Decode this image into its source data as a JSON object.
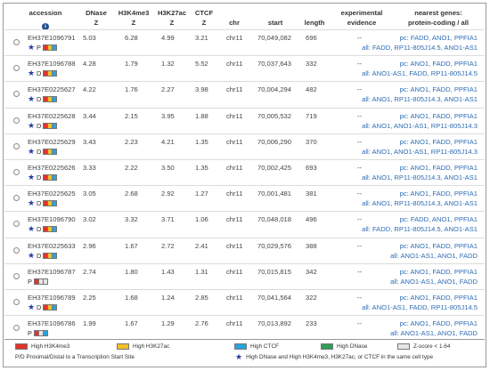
{
  "headers": {
    "accession": "accession",
    "dnase_1": "DNase",
    "dnase_2": "Z",
    "h3k4me3_1": "H3K4me3",
    "h3k4me3_2": "Z",
    "h3k27ac_1": "H3K27ac",
    "h3k27ac_2": "Z",
    "ctcf_1": "CTCF",
    "ctcf_2": "Z",
    "chr": "chr",
    "start": "start",
    "length": "length",
    "exp_1": "experimental",
    "exp_2": "evidence",
    "genes_1": "nearest genes:",
    "genes_2": "protein-coding / all"
  },
  "info_icon": "i",
  "colors": {
    "red": "#e0342c",
    "yellow": "#f2c027",
    "blue": "#2aa3de",
    "green": "#2f9e58",
    "gray": "#e6e6e6"
  },
  "rows": [
    {
      "acc": "EH37E1096791",
      "mark": "P",
      "star": true,
      "swatches": [
        "red",
        "yellow",
        "blue"
      ],
      "dnase": "5.03",
      "h3k4me3": "6.28",
      "h3k27ac": "4.99",
      "ctcf": "3.21",
      "chr": "chr11",
      "start": "70,049,082",
      "length": "696",
      "exp": "--",
      "pc": "pc: FADD, ANO1, PPFIA1",
      "all": "all: FADD, RP11-805J14.5, ANO1-AS1"
    },
    {
      "acc": "EH37E1096788",
      "mark": "D",
      "star": true,
      "swatches": [
        "red",
        "yellow",
        "blue"
      ],
      "dnase": "4.28",
      "h3k4me3": "1.79",
      "h3k27ac": "1.32",
      "ctcf": "5.52",
      "chr": "chr11",
      "start": "70,037,643",
      "length": "332",
      "exp": "--",
      "pc": "pc: ANO1, FADD, PPFIA1",
      "all": "all: ANO1-AS1, FADD, RP11-805J14.5"
    },
    {
      "acc": "EH37E0225627",
      "mark": "D",
      "star": true,
      "swatches": [
        "red",
        "yellow",
        "blue"
      ],
      "dnase": "4.22",
      "h3k4me3": "1.76",
      "h3k27ac": "2.27",
      "ctcf": "3.98",
      "chr": "chr11",
      "start": "70,004,294",
      "length": "482",
      "exp": "--",
      "pc": "pc: ANO1, FADD, PPFIA1",
      "all": "all: ANO1, RP11-805J14.3, ANO1-AS1"
    },
    {
      "acc": "EH37E0225628",
      "mark": "D",
      "star": true,
      "swatches": [
        "red",
        "yellow",
        "blue"
      ],
      "dnase": "3.44",
      "h3k4me3": "2.15",
      "h3k27ac": "3.95",
      "ctcf": "1.88",
      "chr": "chr11",
      "start": "70,005,532",
      "length": "719",
      "exp": "--",
      "pc": "pc: ANO1, FADD, PPFIA1",
      "all": "all: ANO1, ANO1-AS1, RP11-805J14.3"
    },
    {
      "acc": "EH37E0225629",
      "mark": "D",
      "star": true,
      "swatches": [
        "red",
        "yellow",
        "blue"
      ],
      "dnase": "3.43",
      "h3k4me3": "2.23",
      "h3k27ac": "4.21",
      "ctcf": "1.35",
      "chr": "chr11",
      "start": "70,006,290",
      "length": "370",
      "exp": "--",
      "pc": "pc: ANO1, FADD, PPFIA1",
      "all": "all: ANO1, ANO1-AS1, RP11-805J14.3"
    },
    {
      "acc": "EH37E0225626",
      "mark": "D",
      "star": true,
      "swatches": [
        "red",
        "yellow",
        "blue"
      ],
      "dnase": "3.33",
      "h3k4me3": "2.22",
      "h3k27ac": "3.50",
      "ctcf": "1.35",
      "chr": "chr11",
      "start": "70,002,425",
      "length": "693",
      "exp": "--",
      "pc": "pc: ANO1, FADD, PPFIA1",
      "all": "all: ANO1, RP11-805J14.3, ANO1-AS1"
    },
    {
      "acc": "EH37E0225625",
      "mark": "D",
      "star": true,
      "swatches": [
        "red",
        "yellow",
        "blue"
      ],
      "dnase": "3.05",
      "h3k4me3": "2.68",
      "h3k27ac": "2.92",
      "ctcf": "1.27",
      "chr": "chr11",
      "start": "70,001,481",
      "length": "381",
      "exp": "--",
      "pc": "pc: ANO1, FADD, PPFIA1",
      "all": "all: ANO1, RP11-805J14.3, ANO1-AS1"
    },
    {
      "acc": "EH37E1096790",
      "mark": "D",
      "star": true,
      "swatches": [
        "red",
        "yellow",
        "blue"
      ],
      "dnase": "3.02",
      "h3k4me3": "3.32",
      "h3k27ac": "3.71",
      "ctcf": "1.06",
      "chr": "chr11",
      "start": "70,048,018",
      "length": "496",
      "exp": "--",
      "pc": "pc: FADD, ANO1, PPFIA1",
      "all": "all: FADD, RP11-805J14.5, ANO1-AS1"
    },
    {
      "acc": "EH37E0225633",
      "mark": "D",
      "star": true,
      "swatches": [
        "red",
        "yellow",
        "blue"
      ],
      "dnase": "2.96",
      "h3k4me3": "1.67",
      "h3k27ac": "2.72",
      "ctcf": "2.41",
      "chr": "chr11",
      "start": "70,029,576",
      "length": "388",
      "exp": "--",
      "pc": "pc: ANO1, FADD, PPFIA1",
      "all": "all: ANO1-AS1, ANO1, FADD"
    },
    {
      "acc": "EH37E1096787",
      "mark": "P",
      "star": false,
      "swatches": [
        "red",
        "gray",
        "gray"
      ],
      "dnase": "2.74",
      "h3k4me3": "1.80",
      "h3k27ac": "1.43",
      "ctcf": "1.31",
      "chr": "chr11",
      "start": "70,015,815",
      "length": "342",
      "exp": "--",
      "pc": "pc: ANO1, FADD, PPFIA1",
      "all": "all: ANO1-AS1, ANO1, FADD"
    },
    {
      "acc": "EH37E1096789",
      "mark": "D",
      "star": true,
      "swatches": [
        "red",
        "yellow",
        "blue"
      ],
      "dnase": "2.25",
      "h3k4me3": "1.68",
      "h3k27ac": "1.24",
      "ctcf": "2.85",
      "chr": "chr11",
      "start": "70,041,564",
      "length": "322",
      "exp": "--",
      "pc": "pc: ANO1, FADD, PPFIA1",
      "all": "all: ANO1-AS1, FADD, RP11-805J14.5"
    },
    {
      "acc": "EH37E1096786",
      "mark": "P",
      "star": false,
      "swatches": [
        "red",
        "gray",
        "blue"
      ],
      "dnase": "1.99",
      "h3k4me3": "1.67",
      "h3k27ac": "1.29",
      "ctcf": "2.76",
      "chr": "chr11",
      "start": "70,013,892",
      "length": "233",
      "exp": "--",
      "pc": "pc: ANO1, FADD, PPFIA1",
      "all": "all: ANO1-AS1, ANO1, FADD"
    }
  ],
  "legend": {
    "h3k4me3": "High H3K4me3",
    "h3k27ac": "High H3K27ac",
    "ctcf": "High CTCF",
    "dnase": "High DNase",
    "zscore": "Z-score < 1.64",
    "pd": "P/D Proximal/Distal to a Transcription Start Site",
    "star": "High DNase and High H3K4me3, H3K27ac, or CTCF in the same cell type"
  }
}
